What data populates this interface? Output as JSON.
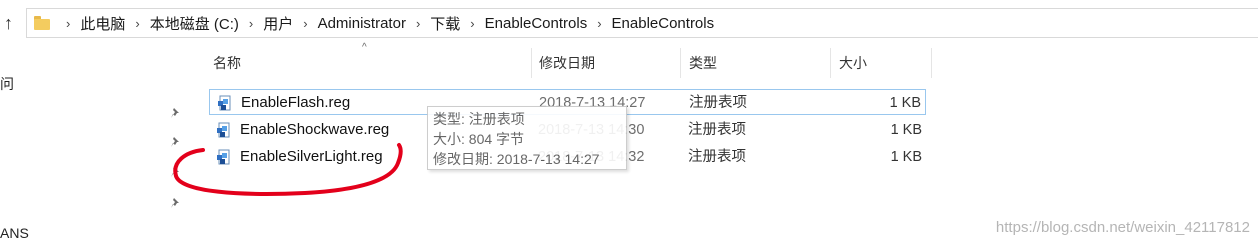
{
  "address": {
    "segments": [
      "此电脑",
      "本地磁盘 (C:)",
      "用户",
      "Administrator",
      "下载",
      "EnableControls",
      "EnableControls"
    ]
  },
  "nav_fragments": {
    "top": "问",
    "bottom": "ANS"
  },
  "columns": {
    "name": "名称",
    "date": "修改日期",
    "type": "类型",
    "size": "大小"
  },
  "files": [
    {
      "name": "EnableFlash.reg",
      "date": "2018-7-13 14:27",
      "type": "注册表项",
      "size": "1 KB",
      "icon": "registry-file-icon"
    },
    {
      "name": "EnableShockwave.reg",
      "date": "2018-7-13 14:30",
      "type": "注册表项",
      "size": "1 KB",
      "icon": "registry-file-icon"
    },
    {
      "name": "EnableSilverLight.reg",
      "date": "2018-7-13 14:32",
      "type": "注册表项",
      "size": "1 KB",
      "icon": "registry-file-icon"
    }
  ],
  "tooltip": {
    "type_line": "类型: 注册表项",
    "size_line": "大小: 804 字节",
    "date_line": "修改日期: 2018-7-13 14:27"
  },
  "annotation_color": "#e3001b",
  "watermark": "https://blog.csdn.net/weixin_42117812"
}
